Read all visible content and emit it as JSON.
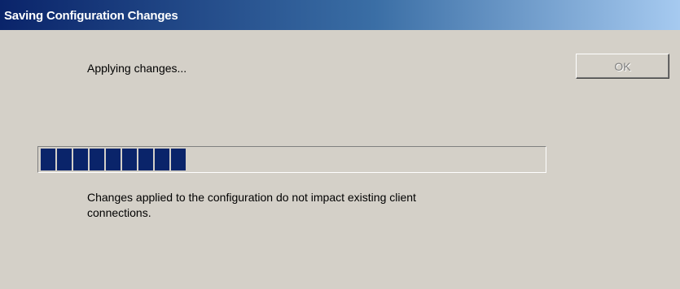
{
  "window": {
    "title": "Saving Configuration Changes"
  },
  "dialog": {
    "status_text": "Applying changes...",
    "ok_label": "OK",
    "ok_enabled": false,
    "progress_fraction": 0.32,
    "info_text": "Changes applied to the configuration do not impact existing client connections."
  },
  "colors": {
    "titlebar_start": "#0a246a",
    "titlebar_end": "#a6caf0",
    "progress_block": "#0a246a",
    "dialog_background": "#d4d0c8",
    "disabled_text": "#808080"
  }
}
